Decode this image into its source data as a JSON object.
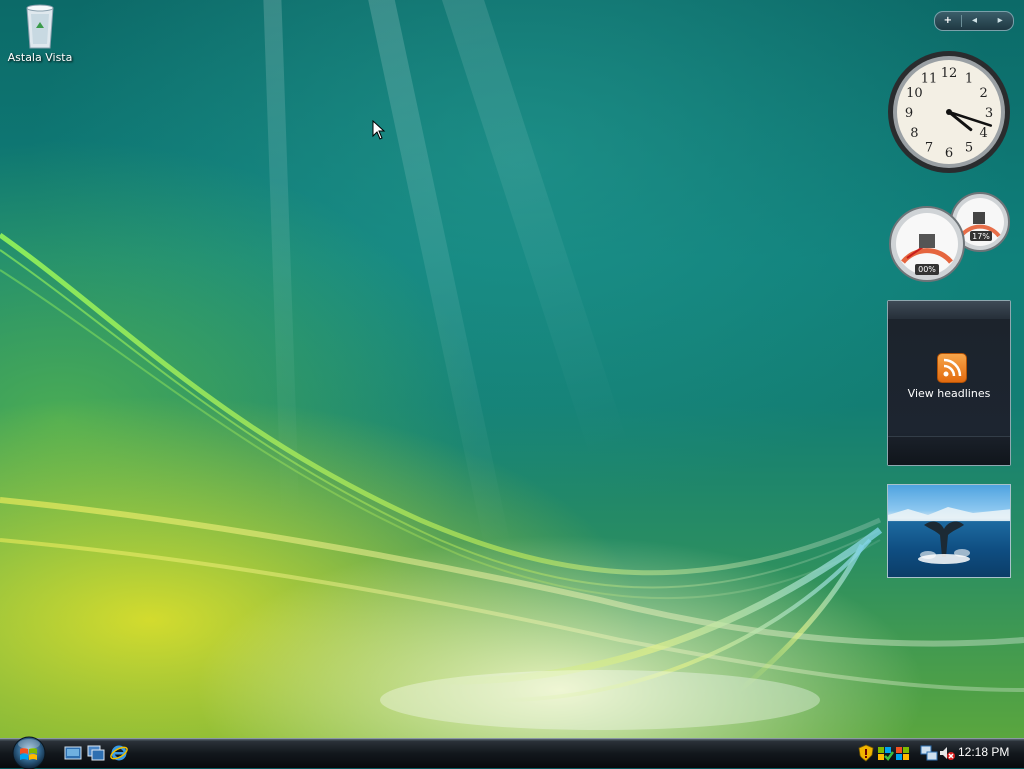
{
  "desktop": {
    "icons": [
      {
        "label": "Astala Vista",
        "icon": "recycle-bin-icon"
      }
    ]
  },
  "sidebar": {
    "controls": {
      "add": "+",
      "prev": "◂",
      "next": "▸"
    },
    "clock_gadget": {
      "hour": 4,
      "minute": 18,
      "numerals": [
        "12",
        "1",
        "2",
        "3",
        "4",
        "5",
        "6",
        "7",
        "8",
        "9",
        "10",
        "11"
      ]
    },
    "cpu_meter": {
      "cpu_label": "00%",
      "memory_label": "17%"
    },
    "feed_headlines": {
      "label": "View headlines"
    },
    "slide_show": {
      "icon": "whale-tail-photo"
    }
  },
  "taskbar": {
    "start": {
      "icon": "windows-start-orb-icon"
    },
    "quick_launch": [
      {
        "name": "show-desktop-icon"
      },
      {
        "name": "switch-windows-icon"
      },
      {
        "name": "internet-explorer-icon"
      }
    ],
    "tray": [
      {
        "name": "security-shield-icon"
      },
      {
        "name": "windows-update-icon"
      },
      {
        "name": "network-flag-icon"
      },
      {
        "name": "network-connection-icon"
      },
      {
        "name": "volume-muted-icon"
      }
    ],
    "clock": "12:18 PM"
  },
  "colors": {
    "accent_green": "#6fd24a",
    "accent_yellow": "#e6e23a",
    "taskbar": "#12171c"
  }
}
